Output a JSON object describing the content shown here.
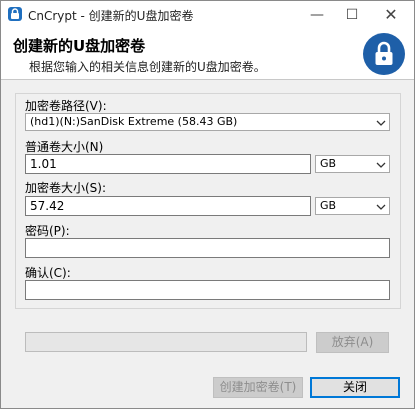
{
  "window": {
    "title": "CnCrypt - 创建新的U盘加密卷"
  },
  "header": {
    "title": "创建新的U盘加密卷",
    "subtitle": "根据您输入的相关信息创建新的U盘加密卷。"
  },
  "form": {
    "path_label": "加密卷路径(V):",
    "path_value": "(hd1)(N:)SanDisk Extreme (58.43 GB)",
    "normal_size_label": "普通卷大小(N)",
    "normal_size_value": "1.01",
    "normal_unit": "GB",
    "encrypted_size_label": "加密卷大小(S):",
    "encrypted_size_value": "57.42",
    "encrypted_unit": "GB",
    "password_label": "密码(P):",
    "password_value": "",
    "confirm_label": "确认(C):",
    "confirm_value": ""
  },
  "progress": {
    "value": 0
  },
  "buttons": {
    "abandon": "放弃(A)",
    "create": "创建加密卷(T)",
    "close": "关闭"
  },
  "colors": {
    "accent": "#1e5fa8",
    "progress_fill": "#06b025"
  }
}
